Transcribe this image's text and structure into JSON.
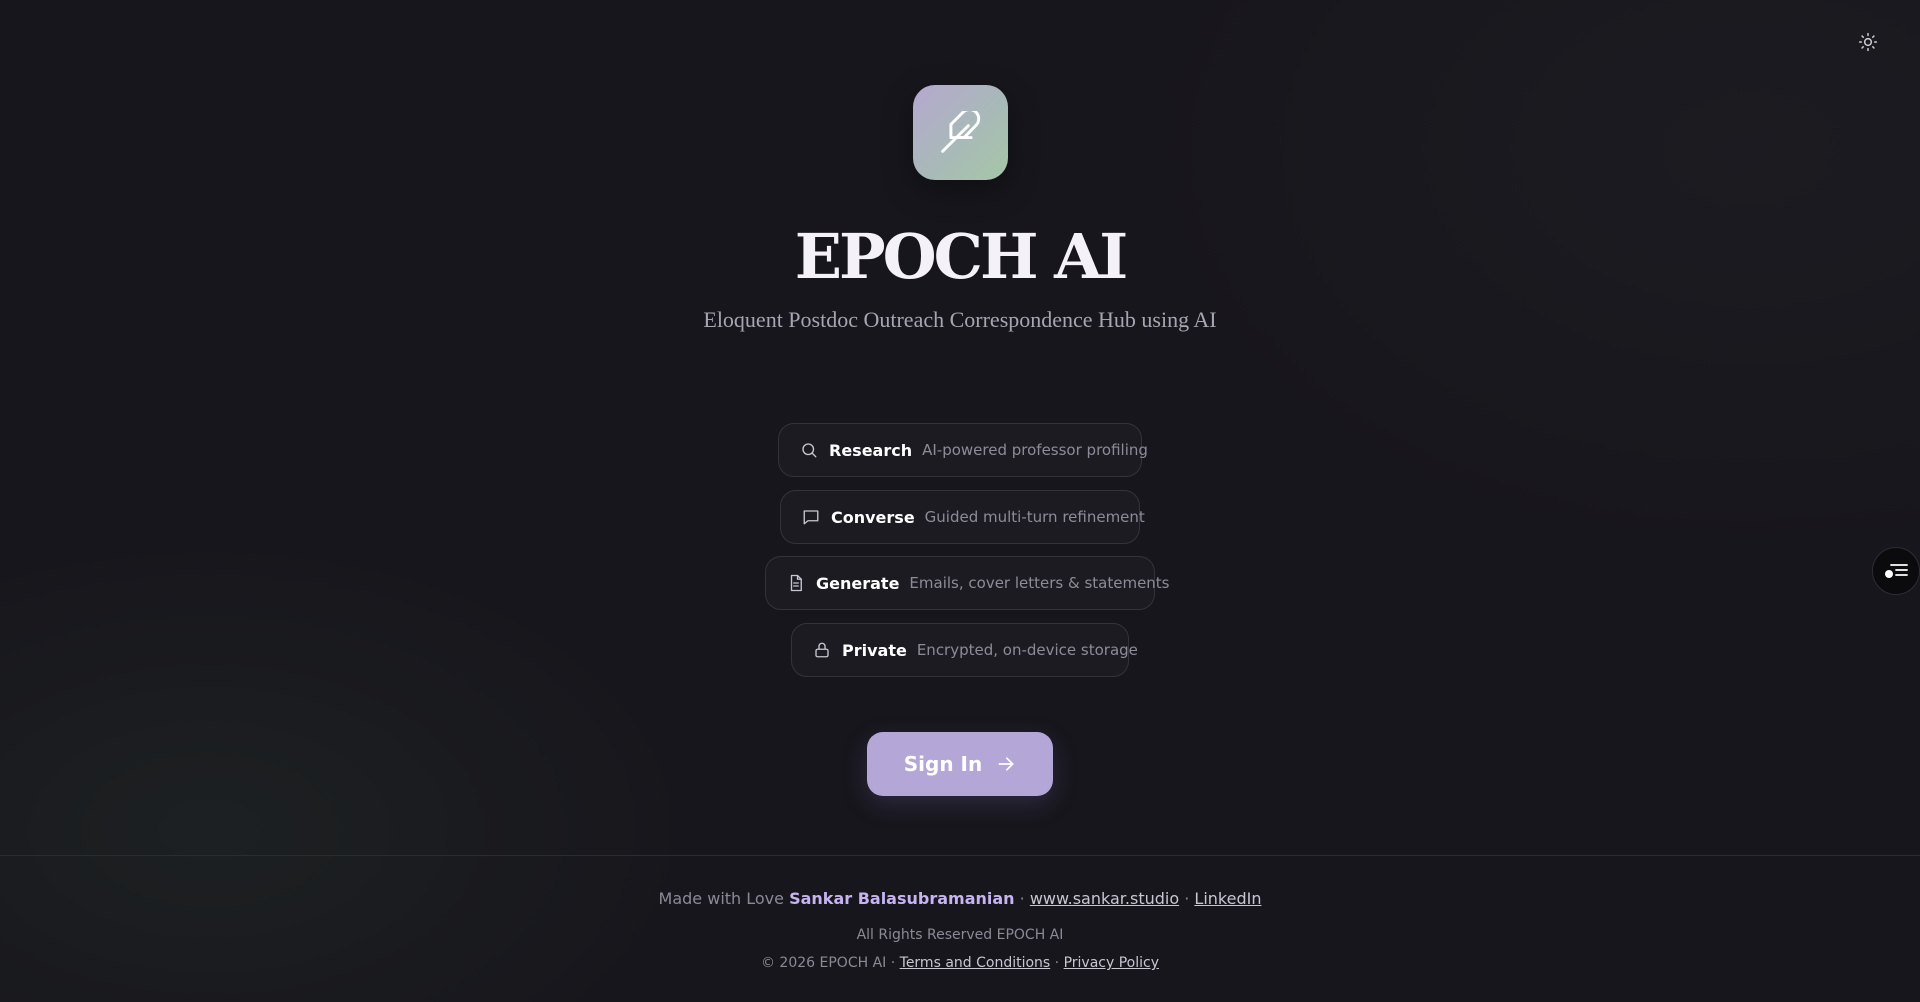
{
  "header": {
    "theme_toggle_icon": "sun-icon"
  },
  "side_fab": {
    "icon": "feedback-icon"
  },
  "hero": {
    "logo_icon": "feather-icon",
    "title": "EPOCH AI",
    "subtitle": "Eloquent Postdoc Outreach Correspondence Hub using AI"
  },
  "features": [
    {
      "icon": "search-icon",
      "name": "Research",
      "desc": "AI-powered professor profiling"
    },
    {
      "icon": "chat-icon",
      "name": "Converse",
      "desc": "Guided multi-turn refinement"
    },
    {
      "icon": "document-icon",
      "name": "Generate",
      "desc": "Emails, cover letters & statements"
    },
    {
      "icon": "lock-icon",
      "name": "Private",
      "desc": "Encrypted, on-device storage"
    }
  ],
  "signin": {
    "label": "Sign In",
    "icon": "arrow-right-icon"
  },
  "footer": {
    "made_with": "Made with Love",
    "author": "Sankar Balasubramanian",
    "website": "www.sankar.studio",
    "linkedin": "LinkedIn",
    "separator": "·",
    "rights": "All Rights Reserved EPOCH AI",
    "copyright": "© 2026 EPOCH AI",
    "terms": "Terms and Conditions",
    "privacy": "Privacy Policy"
  },
  "colors": {
    "background": "#17161c",
    "accent": "#b4a6d6",
    "author": "#c6b3f0"
  }
}
